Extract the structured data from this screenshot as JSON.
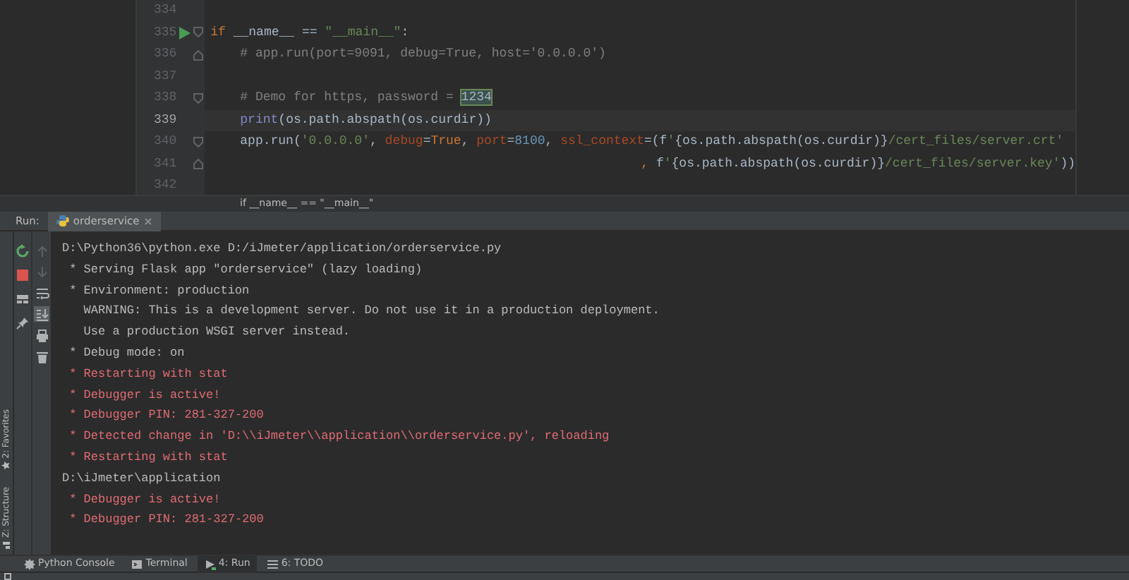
{
  "editor": {
    "lines": [
      {
        "number": "334",
        "current": false,
        "run_marker": false,
        "fold_start": false,
        "fold_end": false
      },
      {
        "number": "335",
        "current": false,
        "run_marker": true,
        "fold_start": true,
        "fold_end": false,
        "indented": false,
        "continuation": false,
        "tokens": [
          {
            "kind": "keyword",
            "text": "if "
          },
          {
            "kind": "plain",
            "text": "__name__ == "
          },
          {
            "kind": "string",
            "text": "\"__main__\""
          },
          {
            "kind": "plain",
            "text": ":"
          }
        ]
      },
      {
        "number": "336",
        "current": false,
        "run_marker": false,
        "fold_start": false,
        "fold_end": true,
        "indented": true,
        "continuation": false,
        "tokens": [
          {
            "kind": "comment",
            "text": "# app.run(port=9091, debug=True, host='0.0.0.0')"
          }
        ]
      },
      {
        "number": "337",
        "current": false,
        "run_marker": false,
        "fold_start": false,
        "fold_end": false
      },
      {
        "number": "338",
        "current": false,
        "run_marker": false,
        "fold_start": true,
        "fold_end": false,
        "indented": true,
        "continuation": false,
        "tokens": [
          {
            "kind": "comment",
            "text": "# Demo for https, password = "
          },
          {
            "kind": "highlight",
            "text": "1234"
          }
        ]
      },
      {
        "number": "339",
        "current": true,
        "run_marker": false,
        "fold_start": false,
        "fold_end": false,
        "indented": true,
        "continuation": false,
        "tokens": [
          {
            "kind": "builtin",
            "text": "print"
          },
          {
            "kind": "plain",
            "text": "(os.path.abspath(os.curdir))"
          }
        ]
      },
      {
        "number": "340",
        "current": false,
        "run_marker": false,
        "fold_start": true,
        "fold_end": false,
        "indented": true,
        "continuation": false,
        "tokens": [
          {
            "kind": "plain",
            "text": "app.run("
          },
          {
            "kind": "string",
            "text": "'0.0.0.0'"
          },
          {
            "kind": "plain",
            "text": ", "
          },
          {
            "kind": "param",
            "text": "debug"
          },
          {
            "kind": "plain",
            "text": "="
          },
          {
            "kind": "keyword",
            "text": "True"
          },
          {
            "kind": "plain",
            "text": ", "
          },
          {
            "kind": "param",
            "text": "port"
          },
          {
            "kind": "plain",
            "text": "="
          },
          {
            "kind": "number",
            "text": "8100"
          },
          {
            "kind": "plain",
            "text": ", "
          },
          {
            "kind": "param",
            "text": "ssl_context"
          },
          {
            "kind": "plain",
            "text": "=(f"
          },
          {
            "kind": "string",
            "text": "'"
          },
          {
            "kind": "plain",
            "text": "{os.path.abspath(os.curdir)}"
          },
          {
            "kind": "string",
            "text": "/cert_files/server.crt'"
          }
        ]
      },
      {
        "number": "341",
        "current": false,
        "run_marker": false,
        "fold_start": false,
        "fold_end": true,
        "indented": true,
        "continuation": true,
        "tokens": [
          {
            "kind": "keyword",
            "text": ", "
          },
          {
            "kind": "plain",
            "text": "f"
          },
          {
            "kind": "string",
            "text": "'"
          },
          {
            "kind": "plain",
            "text": "{os.path.abspath(os.curdir)}"
          },
          {
            "kind": "string",
            "text": "/cert_files/server.key'"
          },
          {
            "kind": "plain",
            "text": "))"
          }
        ]
      },
      {
        "number": "342",
        "current": false,
        "run_marker": false,
        "fold_start": false,
        "fold_end": false
      }
    ],
    "breadcrumb": "if __name__ == \"__main__\""
  },
  "run_panel": {
    "label": "Run:",
    "tabs": [
      {
        "label": "orderservice",
        "selected": true
      }
    ],
    "toolbar": [
      {
        "kind": "rerun",
        "selected": false
      },
      {
        "kind": "stop",
        "selected": false
      },
      {
        "kind": "layout",
        "selected": false
      },
      {
        "kind": "pin",
        "selected": false
      }
    ],
    "toolbar_2": [
      {
        "kind": "up",
        "selected": false
      },
      {
        "kind": "down",
        "selected": false
      },
      {
        "kind": "wrap",
        "selected": false
      },
      {
        "kind": "scroll-end",
        "selected": true
      },
      {
        "kind": "print",
        "selected": false
      },
      {
        "kind": "trash",
        "selected": false
      }
    ],
    "console_lines": [
      {
        "kind": "stdout",
        "text": "D:\\Python36\\python.exe D:/iJmeter/application/orderservice.py"
      },
      {
        "kind": "stdout",
        "text": " * Serving Flask app \"orderservice\" (lazy loading)"
      },
      {
        "kind": "stdout",
        "text": " * Environment: production"
      },
      {
        "kind": "stdout",
        "text": "   WARNING: This is a development server. Do not use it in a production deployment."
      },
      {
        "kind": "stdout",
        "text": "   Use a production WSGI server instead."
      },
      {
        "kind": "stdout",
        "text": " * Debug mode: on"
      },
      {
        "kind": "stderr",
        "text": " * Restarting with stat"
      },
      {
        "kind": "stderr",
        "text": " * Debugger is active!"
      },
      {
        "kind": "stderr",
        "text": " * Debugger PIN: 281-327-200"
      },
      {
        "kind": "stderr",
        "text": " * Detected change in 'D:\\\\iJmeter\\\\application\\\\orderservice.py', reloading"
      },
      {
        "kind": "stderr",
        "text": " * Restarting with stat"
      },
      {
        "kind": "stdout",
        "text": "D:\\iJmeter\\application"
      },
      {
        "kind": "stderr",
        "text": " * Debugger is active!"
      },
      {
        "kind": "stderr",
        "text": " * Debugger PIN: 281-327-200"
      }
    ]
  },
  "side_tabs": [
    {
      "kind": "favorites",
      "label": "2: Favorites"
    },
    {
      "kind": "structure",
      "label": "Z: Structure"
    }
  ],
  "bottom_tabs": [
    {
      "kind": "console",
      "label": "Python Console",
      "selected": false
    },
    {
      "kind": "terminal",
      "label": "Terminal",
      "selected": false
    },
    {
      "kind": "run",
      "label": "4: Run",
      "selected": true
    },
    {
      "kind": "todo",
      "label": "6: TODO",
      "selected": false
    }
  ]
}
